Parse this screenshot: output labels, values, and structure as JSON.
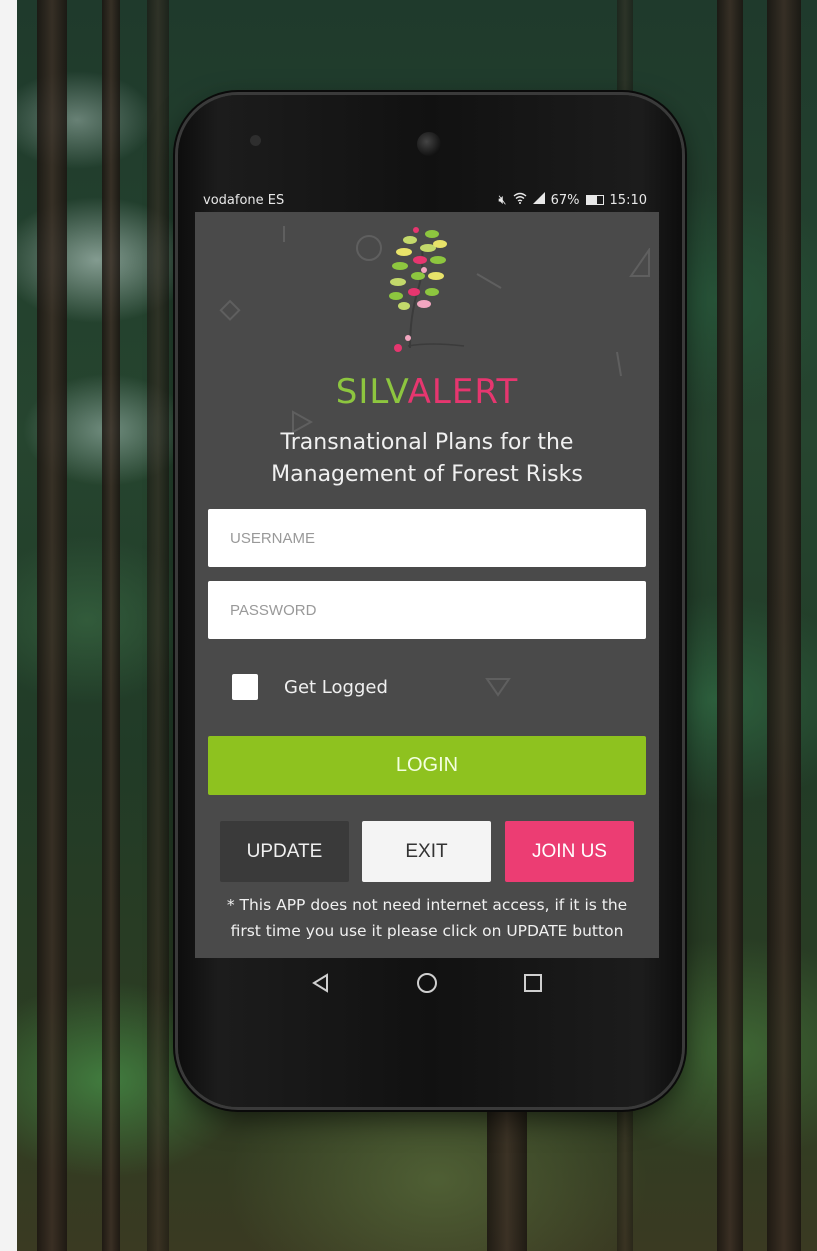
{
  "status_bar": {
    "carrier": "vodafone ES",
    "battery": "67%",
    "time": "15:10",
    "icons": [
      "mute-icon",
      "wifi-icon",
      "signal-icon",
      "battery-icon"
    ]
  },
  "app": {
    "name_part1": "SILV",
    "name_part2": "ALERT",
    "subtitle_line1": "Transnational Plans for the",
    "subtitle_line2": "Management of Forest Risks",
    "brand_green": "#8dc63f",
    "brand_pink": "#e6366f"
  },
  "form": {
    "username_placeholder": "USERNAME",
    "password_placeholder": "PASSWORD",
    "remember_label": "Get Logged",
    "login_label": "LOGIN"
  },
  "actions": {
    "update_label": "UPDATE",
    "exit_label": "EXIT",
    "join_label": "JOIN US"
  },
  "note": {
    "line1": "* This APP does not need internet access, if it is the",
    "line2": "first time you use it please click on UPDATE button"
  },
  "navbar": {
    "icons": [
      "back-icon",
      "home-icon",
      "recents-icon"
    ]
  }
}
